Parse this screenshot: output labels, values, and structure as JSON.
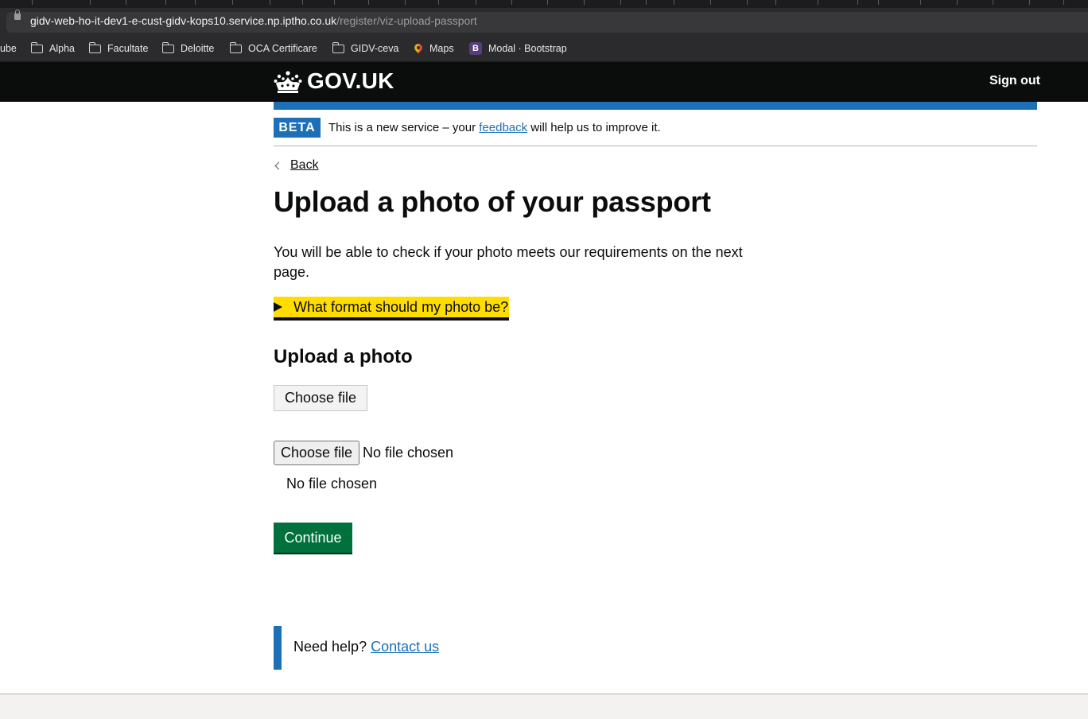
{
  "browser": {
    "url_host": "gidv-web-ho-it-dev1-e-cust-gidv-kops10.service.np.iptho.co.uk",
    "url_path": "/register/viz-upload-passport",
    "bookmarks": [
      {
        "label": "ube",
        "icon": "none"
      },
      {
        "label": "Alpha",
        "icon": "folder-icon"
      },
      {
        "label": "Facultate",
        "icon": "folder-icon"
      },
      {
        "label": "Deloitte",
        "icon": "folder-icon"
      },
      {
        "label": "OCA Certificare",
        "icon": "folder-icon"
      },
      {
        "label": "GIDV-ceva",
        "icon": "folder-icon"
      },
      {
        "label": "Maps",
        "icon": "maps-pin-icon"
      },
      {
        "label": "Modal · Bootstrap",
        "icon": "bootstrap-icon",
        "icon_text": "B"
      }
    ]
  },
  "header": {
    "logotype": "GOV.UK",
    "sign_out": "Sign out",
    "crown_icon": "crown-icon"
  },
  "phase_banner": {
    "tag": "BETA",
    "text_before": "This is a new service – your ",
    "link": "feedback",
    "text_after": " will help us to improve it."
  },
  "main": {
    "back_link": "Back",
    "title": "Upload a photo of your passport",
    "lead": "You will be able to check if your photo meets our requirements on the next page.",
    "details_summary": "What format should my photo be?",
    "upload_heading": "Upload a photo",
    "choose_file_button": "Choose file",
    "native_choose_file": "Choose file",
    "native_no_file": "No file chosen",
    "no_file_chosen": "No file chosen",
    "continue_button": "Continue",
    "help_prefix": "Need help? ",
    "help_link": "Contact us"
  },
  "colors": {
    "header_bg": "#0b0c0c",
    "brand_blue": "#1d70b8",
    "focus_yellow": "#ffdd00",
    "button_green": "#00703c",
    "footer_bg": "#f3f2f1"
  }
}
